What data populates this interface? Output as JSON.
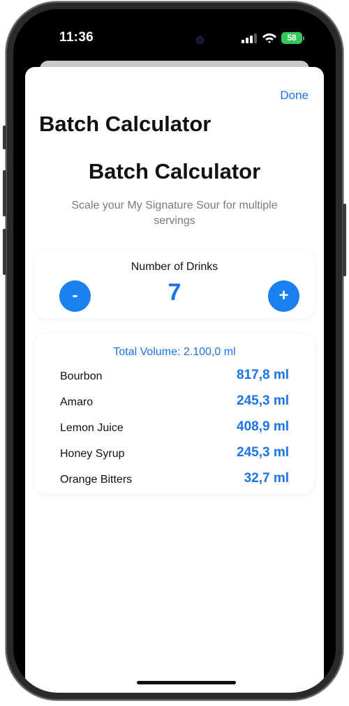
{
  "status_bar": {
    "time": "11:36",
    "battery": "58",
    "battery_color": "#34c759"
  },
  "sheet": {
    "done_label": "Done",
    "nav_title": "Batch Calculator"
  },
  "header": {
    "title": "Batch Calculator",
    "subtitle": "Scale your My Signature Sour for multiple servings"
  },
  "counter": {
    "label": "Number of Drinks",
    "value": "7",
    "minus_label": "-",
    "plus_label": "+"
  },
  "ingredients": {
    "total_volume": "Total Volume: 2.100,0 ml",
    "items": [
      {
        "name": "Bourbon",
        "amount": "817,8 ml"
      },
      {
        "name": "Amaro",
        "amount": "245,3 ml"
      },
      {
        "name": "Lemon Juice",
        "amount": "408,9 ml"
      },
      {
        "name": "Honey Syrup",
        "amount": "245,3 ml"
      },
      {
        "name": "Orange Bitters",
        "amount": "32,7 ml"
      }
    ]
  },
  "colors": {
    "accent": "#1a73e8",
    "button": "#1a7ff0"
  },
  "icons": [
    "cellular-signal-icon",
    "wifi-icon",
    "battery-icon"
  ]
}
